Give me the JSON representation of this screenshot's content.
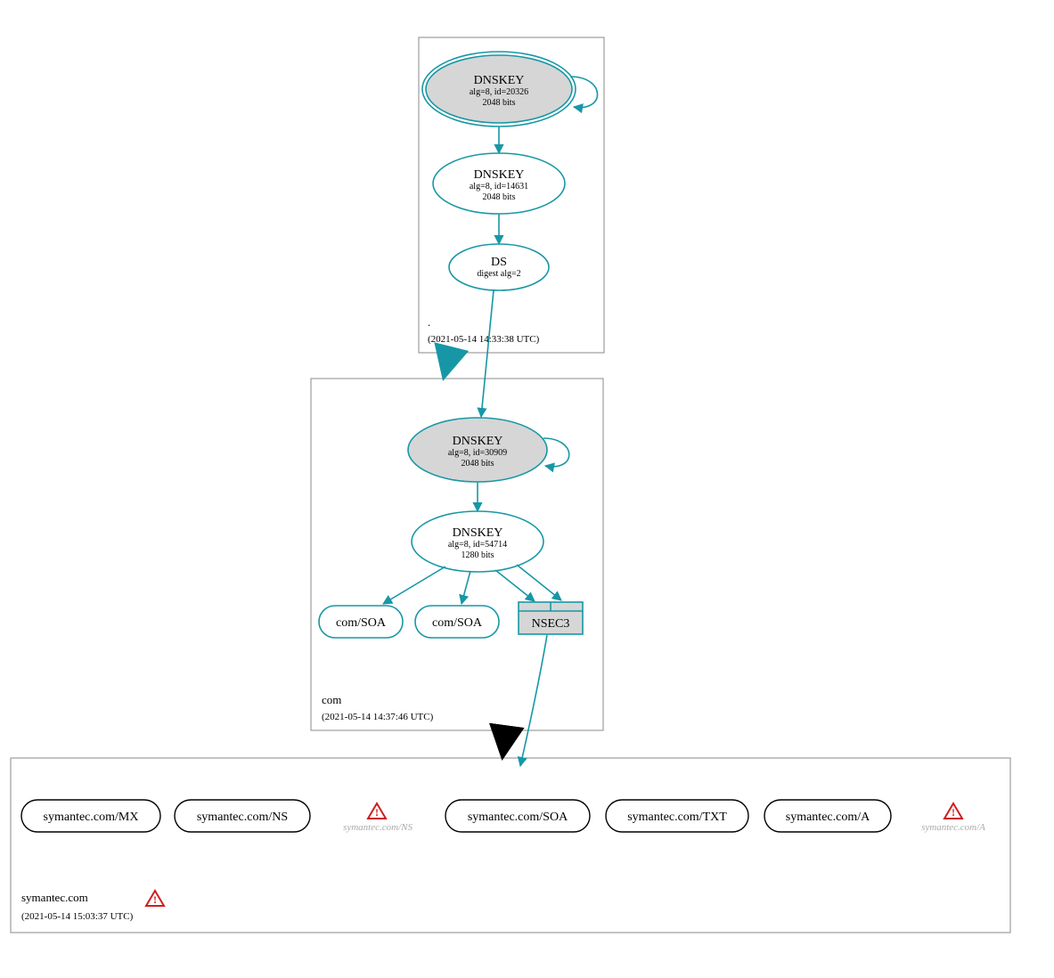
{
  "colors": {
    "teal": "#1797a6",
    "grayfill": "#d6d6d6",
    "black": "#000000",
    "boxgray": "#888888",
    "warnRed": "#cc1f1f",
    "warnFill": "#ffffff"
  },
  "zones": {
    "root": {
      "name": ".",
      "timestamp": "(2021-05-14 14:33:38 UTC)"
    },
    "com": {
      "name": "com",
      "timestamp": "(2021-05-14 14:37:46 UTC)"
    },
    "symantec": {
      "name": "symantec.com",
      "timestamp": "(2021-05-14 15:03:37 UTC)"
    }
  },
  "nodes": {
    "root_ksk": {
      "title": "DNSKEY",
      "line1": "alg=8, id=20326",
      "line2": "2048 bits"
    },
    "root_zsk": {
      "title": "DNSKEY",
      "line1": "alg=8, id=14631",
      "line2": "2048 bits"
    },
    "root_ds": {
      "title": "DS",
      "line1": "digest alg=2"
    },
    "com_ksk": {
      "title": "DNSKEY",
      "line1": "alg=8, id=30909",
      "line2": "2048 bits"
    },
    "com_zsk": {
      "title": "DNSKEY",
      "line1": "alg=8, id=54714",
      "line2": "1280 bits"
    },
    "com_soa1": {
      "title": "com/SOA"
    },
    "com_soa2": {
      "title": "com/SOA"
    },
    "nsec3": {
      "title": "NSEC3"
    },
    "sy_mx": {
      "title": "symantec.com/MX"
    },
    "sy_ns": {
      "title": "symantec.com/NS"
    },
    "sy_ns_w": {
      "title": "symantec.com/NS"
    },
    "sy_soa": {
      "title": "symantec.com/SOA"
    },
    "sy_txt": {
      "title": "symantec.com/TXT"
    },
    "sy_a": {
      "title": "symantec.com/A"
    },
    "sy_a_w": {
      "title": "symantec.com/A"
    }
  }
}
